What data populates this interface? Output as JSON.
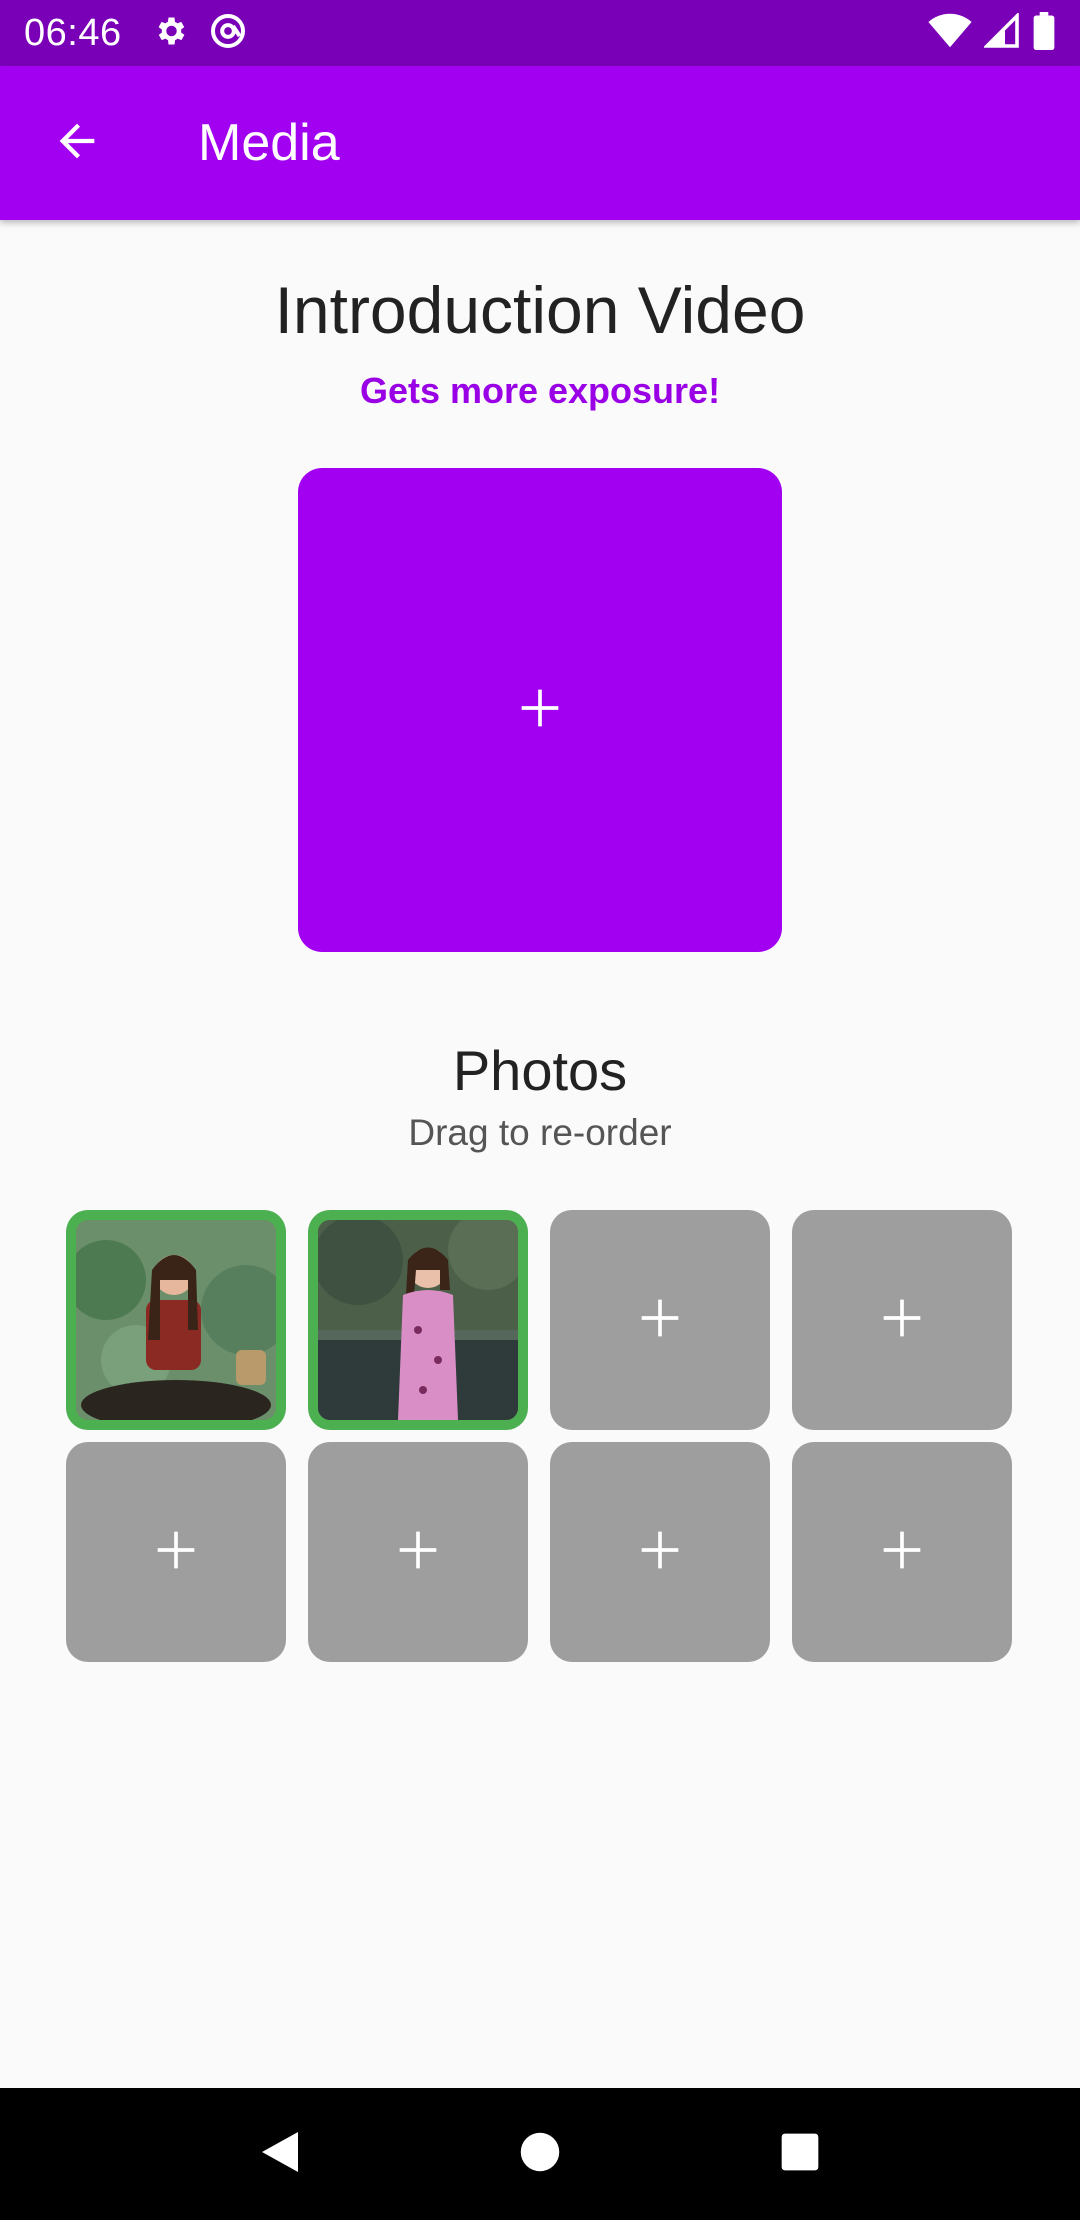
{
  "status_bar": {
    "time": "06:46",
    "icons": [
      "settings-icon",
      "at-sign-icon",
      "wifi-icon",
      "signal-icon",
      "battery-icon"
    ],
    "color": "#7a00b8"
  },
  "app_bar": {
    "title": "Media",
    "back_icon": "arrow-back-icon",
    "color": "#a200f0"
  },
  "intro": {
    "title": "Introduction Video",
    "subtitle": "Gets more exposure!",
    "add_icon": "plus-icon",
    "accent": "#a200f0"
  },
  "photos": {
    "title": "Photos",
    "subtitle": "Drag to re-order",
    "tiles": [
      {
        "state": "filled",
        "content": "photo"
      },
      {
        "state": "filled",
        "content": "photo"
      },
      {
        "state": "empty",
        "content": "plus-icon"
      },
      {
        "state": "empty",
        "content": "plus-icon"
      },
      {
        "state": "empty",
        "content": "plus-icon"
      },
      {
        "state": "empty",
        "content": "plus-icon"
      },
      {
        "state": "empty",
        "content": "plus-icon"
      },
      {
        "state": "empty",
        "content": "plus-icon"
      }
    ],
    "filled_border_color": "#4caf50",
    "empty_color": "#9e9e9e"
  },
  "nav_bar": {
    "buttons": [
      "back-triangle-icon",
      "home-circle-icon",
      "recents-square-icon"
    ]
  }
}
